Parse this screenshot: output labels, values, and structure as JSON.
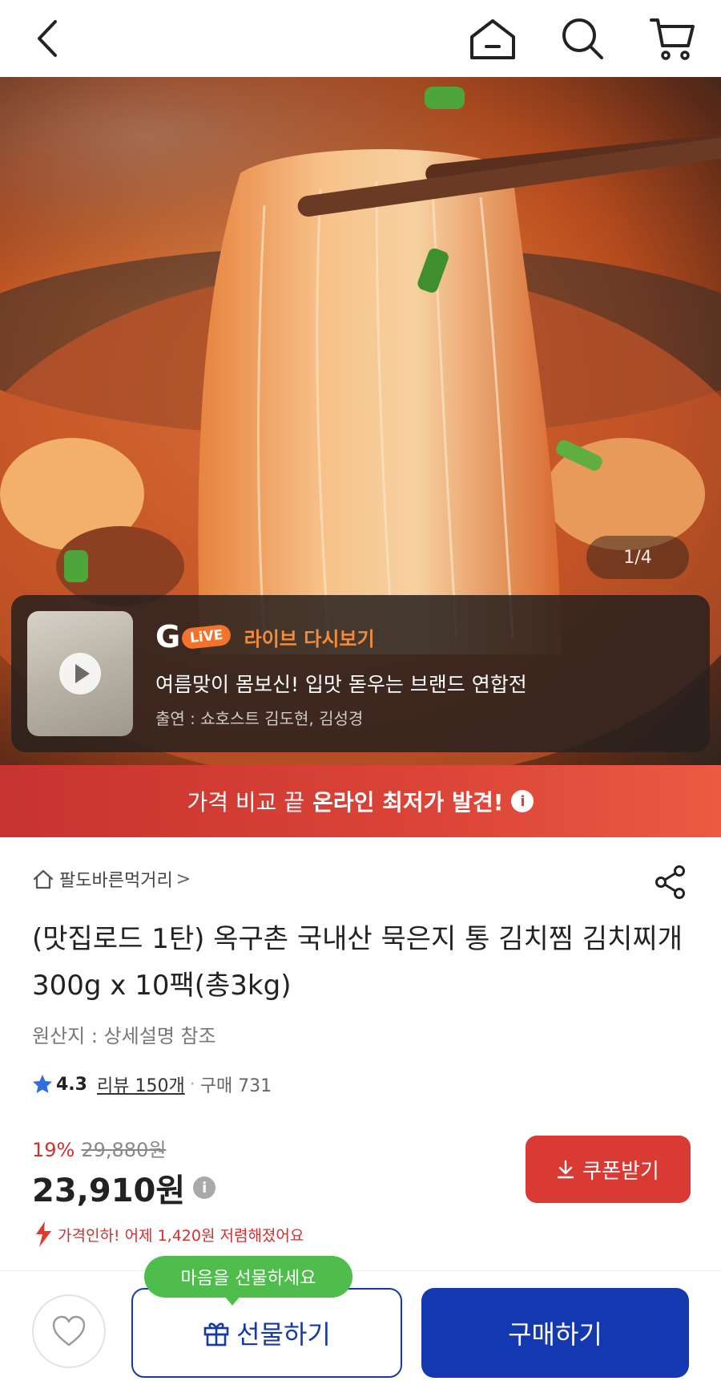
{
  "header": {
    "icons": [
      "back-icon",
      "home-icon",
      "search-icon",
      "cart-icon"
    ]
  },
  "hero": {
    "counter": "1/4",
    "live": {
      "logo_g": "G",
      "logo_live": "LiVE",
      "replay_label": "라이브 다시보기",
      "title": "여름맞이 몸보신! 입맛 돋우는 브랜드 연합전",
      "cast": "출연 : 쇼호스트 김도현, 김성경"
    }
  },
  "banner": {
    "prefix": "가격 비교 끝",
    "highlight": "온라인 최저가 발견!",
    "info": "i"
  },
  "product": {
    "store": "팔도바른먹거리",
    "store_chevron": ">",
    "title": "(맛집로드 1탄) 옥구촌 국내산 묵은지 통 김치찜 김치찌개 300g x 10팩(총3kg)",
    "origin": "원산지 : 상세설명 참조",
    "rating": "4.3",
    "review": "리뷰 150개",
    "dot": "·",
    "buys": "구매 731",
    "discount": "19%",
    "original_price": "29,880원",
    "price": "23,910원",
    "price_info": "i",
    "coupon_label": "쿠폰받기",
    "price_drop": "가격인하! 어제 1,420원 저렴해졌어요"
  },
  "bottom": {
    "bubble": "마음을 선물하세요",
    "gift_label": "선물하기",
    "buy_label": "구매하기"
  },
  "colors": {
    "accent_red": "#d93a33",
    "primary_blue": "#1438b0",
    "bubble_green": "#4fbd4c"
  }
}
